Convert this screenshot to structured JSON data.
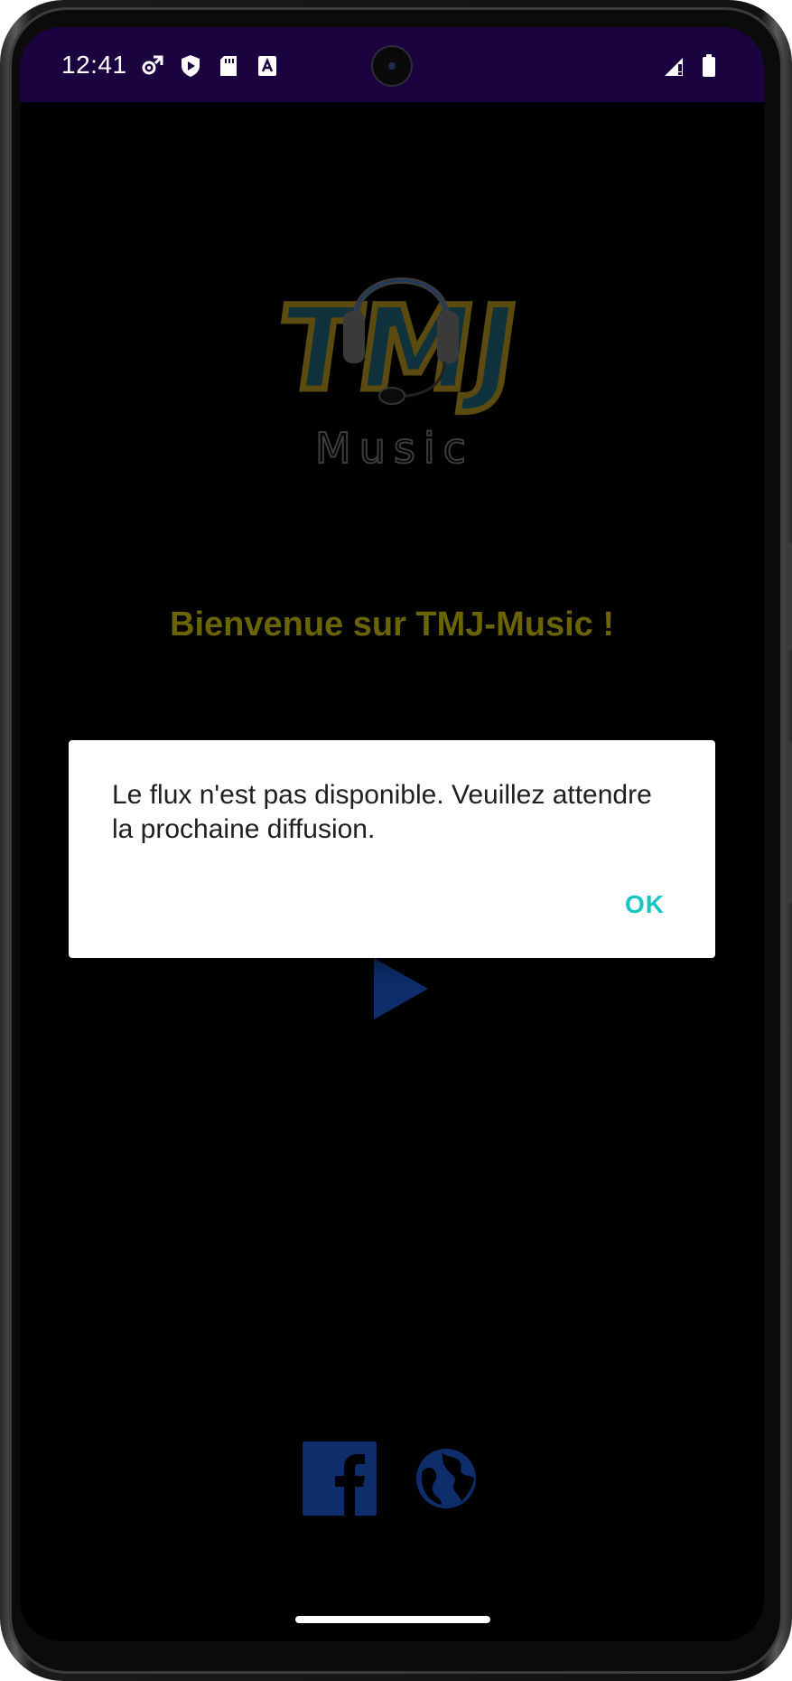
{
  "status_bar": {
    "time": "12:41",
    "left_icons": [
      "settings-sync-icon",
      "play-protect-icon",
      "sd-card-icon",
      "text-a-icon"
    ],
    "right_icons": [
      "signal-icon",
      "battery-icon"
    ],
    "background": "#1b0340"
  },
  "app": {
    "logo_main_text": "TMJ",
    "logo_sub_text": "Music",
    "welcome_text": "Bienvenue sur TMJ-Music !",
    "welcome_color": "#6b6404",
    "accent_color": "#0d2e6b"
  },
  "dialog": {
    "message": "Le flux n'est pas disponible. Veuillez attendre la prochaine diffusion.",
    "ok_label": "OK",
    "ok_color": "#17c6c4"
  },
  "social": {
    "icons": [
      "facebook-icon",
      "globe-icon"
    ]
  }
}
